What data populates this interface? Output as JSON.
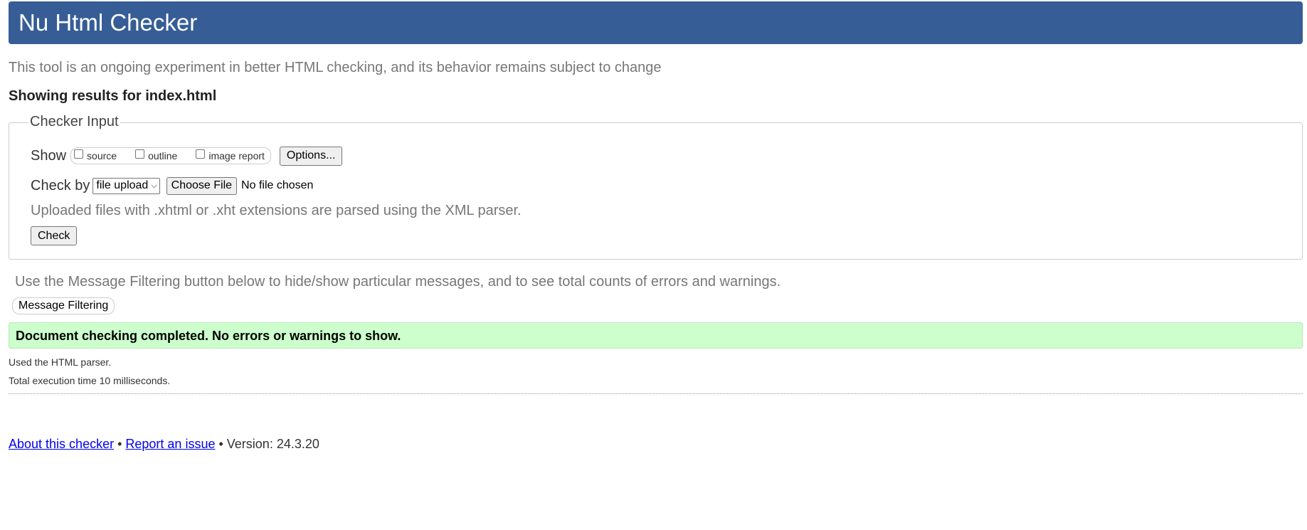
{
  "header": {
    "title": "Nu Html Checker"
  },
  "intro": {
    "text": "This tool is an ongoing experiment in better HTML checking, and its behavior remains subject to change"
  },
  "results": {
    "heading": "Showing results for index.html"
  },
  "checker_input": {
    "legend": "Checker Input",
    "show_label": "Show",
    "show_options": [
      {
        "label": "source",
        "checked": false
      },
      {
        "label": "outline",
        "checked": false
      },
      {
        "label": "image report",
        "checked": false
      }
    ],
    "options_button": "Options...",
    "check_by_label": "Check by",
    "check_by_value": "file upload",
    "choose_file_button": "Choose File",
    "file_status": "No file chosen",
    "xml_note": "Uploaded files with .xhtml or .xht extensions are parsed using the XML parser.",
    "check_button": "Check"
  },
  "filtering": {
    "note": "Use the Message Filtering button below to hide/show particular messages, and to see total counts of errors and warnings.",
    "button": "Message Filtering"
  },
  "status": {
    "message": "Document checking completed. No errors or warnings to show.",
    "parser": "Used the HTML parser.",
    "execution_time": "Total execution time 10 milliseconds."
  },
  "footer": {
    "about_link": "About this checker",
    "separator": "•",
    "report_link": "Report an issue",
    "version": "Version: 24.3.20"
  },
  "colors": {
    "header_bg": "#365d95",
    "success_bg": "#ccffcc",
    "link": "#0000ee"
  }
}
